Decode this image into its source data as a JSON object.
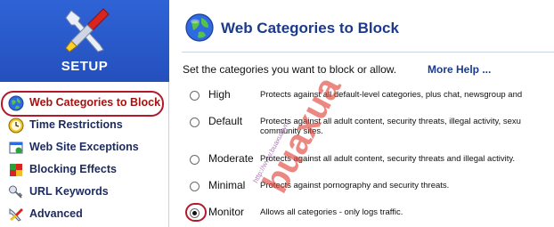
{
  "sidebar": {
    "title": "SETUP",
    "items": [
      {
        "label": "Web Categories to Block",
        "icon": "globe-icon",
        "active": true
      },
      {
        "label": "Time Restrictions",
        "icon": "clock-icon",
        "active": false
      },
      {
        "label": "Web Site Exceptions",
        "icon": "exceptions-icon",
        "active": false
      },
      {
        "label": "Blocking Effects",
        "icon": "blocking-effects-icon",
        "active": false
      },
      {
        "label": "URL Keywords",
        "icon": "key-icon",
        "active": false
      },
      {
        "label": "Advanced",
        "icon": "tools-icon",
        "active": false
      }
    ]
  },
  "main": {
    "title": "Web Categories to Block",
    "instruction": "Set the categories you want to block or allow.",
    "more_help": "More Help ...",
    "options": [
      {
        "label": "High",
        "description": "Protects against all default-level categories, plus chat, newsgroup and",
        "checked": false
      },
      {
        "label": "Default",
        "description": "Protects against all adult content, security threats, illegal activity, sexu community sites.",
        "checked": false
      },
      {
        "label": "Moderate",
        "description": "Protects against all adult content, security threats and illegal activity.",
        "checked": false
      },
      {
        "label": "Minimal",
        "description": "Protects against pornography and security threats.",
        "checked": false
      },
      {
        "label": "Monitor",
        "description": "Allows all categories - only logs traffic.",
        "checked": true
      }
    ]
  },
  "watermark": {
    "text": "buaxua",
    "url": "http://www.buaxua.vn"
  },
  "colors": {
    "header_blue": "#2450bd",
    "title_blue": "#1b3a8a",
    "highlight_red": "#b5182a"
  }
}
